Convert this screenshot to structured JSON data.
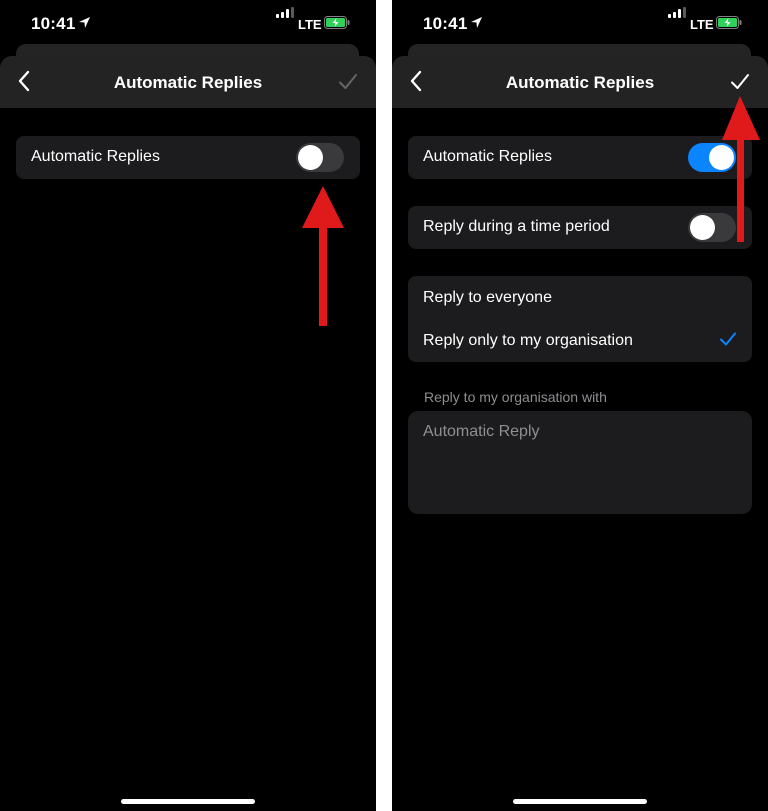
{
  "status_bar": {
    "time": "10:41",
    "network": "LTE"
  },
  "left_screen": {
    "title": "Automatic Replies",
    "automatic_replies_label": "Automatic Replies",
    "automatic_replies_toggle": "off"
  },
  "right_screen": {
    "title": "Automatic Replies",
    "automatic_replies_label": "Automatic Replies",
    "automatic_replies_toggle": "on",
    "time_period_label": "Reply during a time period",
    "time_period_toggle": "off",
    "reply_options": [
      "Reply to everyone",
      "Reply only to my organisation"
    ],
    "selected_option": "Reply only to my organisation",
    "section_label": "Reply to my organisation with",
    "message_placeholder": "Automatic Reply"
  },
  "colors": {
    "toggle_on": "#0a84ff",
    "selection_check": "#0a84ff",
    "annotation_arrow": "#e0191b"
  },
  "icons": [
    "location-arrow-icon",
    "signal-icon",
    "battery-charging-icon",
    "back-chevron-icon",
    "checkmark-icon"
  ]
}
